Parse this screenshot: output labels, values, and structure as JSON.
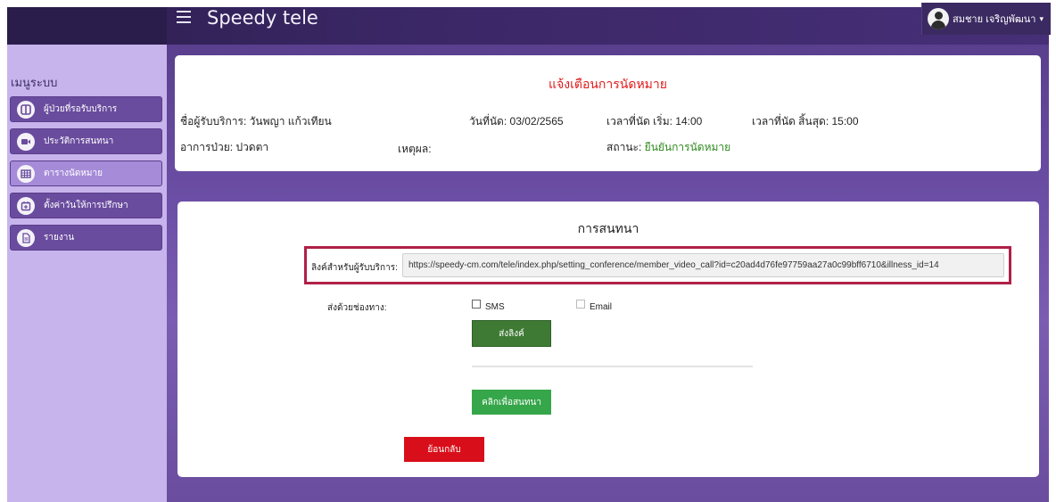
{
  "header": {
    "app_title": "Speedy tele",
    "user_name": "สมชาย เจริญพัฒนา",
    "caret": "▾"
  },
  "sidebar": {
    "title": "เมนูระบบ",
    "items": [
      {
        "label": "ผู้ป่วยที่รอรับบริการ",
        "icon": "columns-icon"
      },
      {
        "label": "ประวัติการสนทนา",
        "icon": "video-icon"
      },
      {
        "label": "ตารางนัดหมาย",
        "icon": "table-icon",
        "active": true
      },
      {
        "label": "ตั้งค่าวันให้การปรึกษา",
        "icon": "calendar-plus-icon"
      },
      {
        "label": "รายงาน",
        "icon": "document-icon"
      }
    ]
  },
  "appointment": {
    "title": "แจ้งเตือนการนัดหมาย",
    "client_label": "ชื่อผู้รับบริการ: วันพญา แก้วเทียน",
    "date_label": "วันที่นัด: 03/02/2565",
    "start_label": "เวลาที่นัด เริ่ม: 14:00",
    "end_label": "เวลาที่นัด สิ้นสุด: 15:00",
    "symptom_label": "อาการป่วย: ปวดตา",
    "reason_label": "เหตุผล:",
    "status_prefix": "สถานะ: ",
    "status_value": "ยืนยันการนัดหมาย"
  },
  "conversation": {
    "title": "การสนทนา",
    "link_label": "ลิงค์สำหรับผู้รับบริการ:",
    "link_value": "https://speedy-cm.com/tele/index.php/setting_conference/member_video_call?id=c20ad4d76fe97759aa27a0c99bff6710&illness_id=14",
    "send_via_label": "ส่งด้วยช่องทาง:",
    "sms_label": "SMS",
    "email_label": "Email",
    "send_button": "ส่งลิงค์",
    "chat_button": "คลิกเพื่อสนทนา",
    "back_button": "ย้อนกลับ"
  },
  "colors": {
    "topbar": "#3b2766",
    "sidebar": "#c8b4ec",
    "nav_item": "#6a4c9e",
    "alert_red": "#e01b1b",
    "status_green": "#2d8a1e",
    "link_border": "#b02048",
    "send_button": "#3e7a34",
    "chat_button": "#36a64a",
    "back_button": "#d80f1a"
  }
}
